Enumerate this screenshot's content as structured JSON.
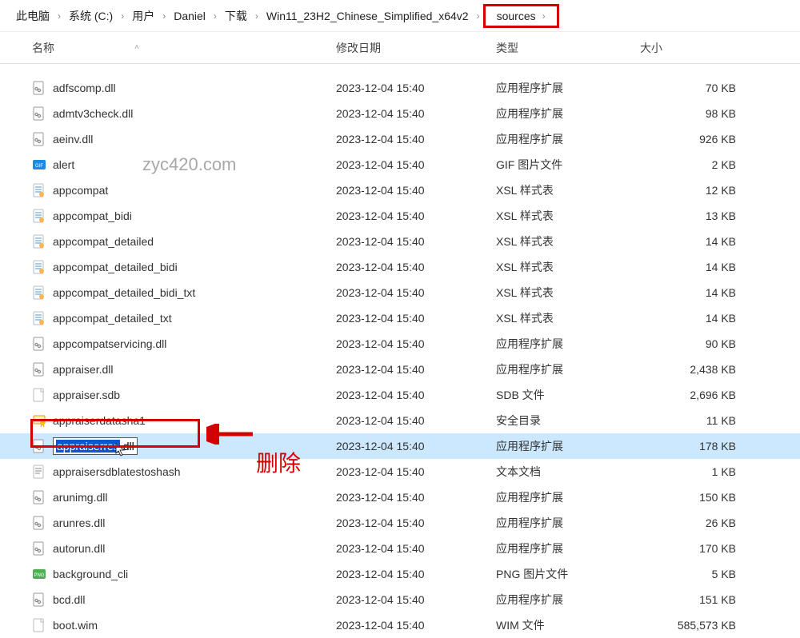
{
  "breadcrumb": {
    "items": [
      "此电脑",
      "系统 (C:)",
      "用户",
      "Daniel",
      "下载",
      "Win11_23H2_Chinese_Simplified_x64v2",
      "sources"
    ],
    "sep": "›"
  },
  "columns": {
    "name": "名称",
    "date": "修改日期",
    "type": "类型",
    "size": "大小"
  },
  "rename": {
    "selected": "appraiserres",
    "after": ".dll"
  },
  "annotation": {
    "delete": "删除"
  },
  "watermark": "zyc420.com",
  "files": [
    {
      "name": "adfscomp.dll",
      "date": "2023-12-04 15:40",
      "type": "应用程序扩展",
      "size": "70 KB",
      "icon": "dll"
    },
    {
      "name": "admtv3check.dll",
      "date": "2023-12-04 15:40",
      "type": "应用程序扩展",
      "size": "98 KB",
      "icon": "dll"
    },
    {
      "name": "aeinv.dll",
      "date": "2023-12-04 15:40",
      "type": "应用程序扩展",
      "size": "926 KB",
      "icon": "dll"
    },
    {
      "name": "alert",
      "date": "2023-12-04 15:40",
      "type": "GIF 图片文件",
      "size": "2 KB",
      "icon": "gif"
    },
    {
      "name": "appcompat",
      "date": "2023-12-04 15:40",
      "type": "XSL 样式表",
      "size": "12 KB",
      "icon": "xsl"
    },
    {
      "name": "appcompat_bidi",
      "date": "2023-12-04 15:40",
      "type": "XSL 样式表",
      "size": "13 KB",
      "icon": "xsl"
    },
    {
      "name": "appcompat_detailed",
      "date": "2023-12-04 15:40",
      "type": "XSL 样式表",
      "size": "14 KB",
      "icon": "xsl"
    },
    {
      "name": "appcompat_detailed_bidi",
      "date": "2023-12-04 15:40",
      "type": "XSL 样式表",
      "size": "14 KB",
      "icon": "xsl"
    },
    {
      "name": "appcompat_detailed_bidi_txt",
      "date": "2023-12-04 15:40",
      "type": "XSL 样式表",
      "size": "14 KB",
      "icon": "xsl"
    },
    {
      "name": "appcompat_detailed_txt",
      "date": "2023-12-04 15:40",
      "type": "XSL 样式表",
      "size": "14 KB",
      "icon": "xsl"
    },
    {
      "name": "appcompatservicing.dll",
      "date": "2023-12-04 15:40",
      "type": "应用程序扩展",
      "size": "90 KB",
      "icon": "dll"
    },
    {
      "name": "appraiser.dll",
      "date": "2023-12-04 15:40",
      "type": "应用程序扩展",
      "size": "2,438 KB",
      "icon": "dll"
    },
    {
      "name": "appraiser.sdb",
      "date": "2023-12-04 15:40",
      "type": "SDB 文件",
      "size": "2,696 KB",
      "icon": "file"
    },
    {
      "name": "appraiserdatasha1",
      "date": "2023-12-04 15:40",
      "type": "安全目录",
      "size": "11 KB",
      "icon": "cert"
    },
    {
      "name": "appraiserres.dll",
      "date": "2023-12-04 15:40",
      "type": "应用程序扩展",
      "size": "178 KB",
      "icon": "dll",
      "selected": true,
      "renaming": true
    },
    {
      "name": "appraisersdblatestoshash",
      "date": "2023-12-04 15:40",
      "type": "文本文档",
      "size": "1 KB",
      "icon": "txt"
    },
    {
      "name": "arunimg.dll",
      "date": "2023-12-04 15:40",
      "type": "应用程序扩展",
      "size": "150 KB",
      "icon": "dll"
    },
    {
      "name": "arunres.dll",
      "date": "2023-12-04 15:40",
      "type": "应用程序扩展",
      "size": "26 KB",
      "icon": "dll"
    },
    {
      "name": "autorun.dll",
      "date": "2023-12-04 15:40",
      "type": "应用程序扩展",
      "size": "170 KB",
      "icon": "dll"
    },
    {
      "name": "background_cli",
      "date": "2023-12-04 15:40",
      "type": "PNG 图片文件",
      "size": "5 KB",
      "icon": "png"
    },
    {
      "name": "bcd.dll",
      "date": "2023-12-04 15:40",
      "type": "应用程序扩展",
      "size": "151 KB",
      "icon": "dll"
    },
    {
      "name": "boot.wim",
      "date": "2023-12-04 15:40",
      "type": "WIM 文件",
      "size": "585,573 KB",
      "icon": "file"
    }
  ]
}
